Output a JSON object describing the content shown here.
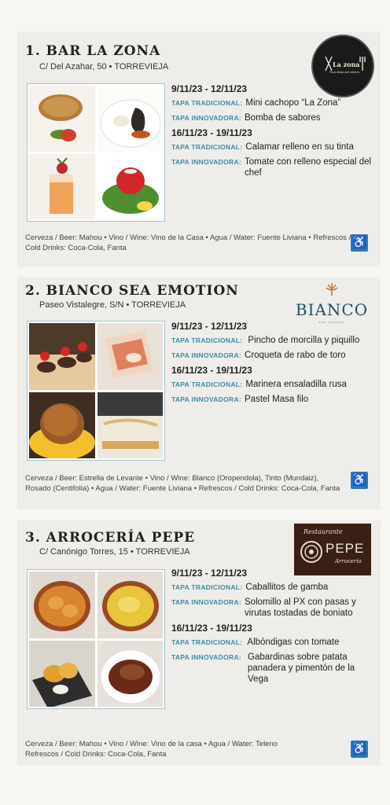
{
  "restaurants": [
    {
      "title": "1. BAR LA ZONA",
      "address": "C/ Del Azahar, 50 • TORREVIEJA",
      "logo": {
        "main": "La zona",
        "sub": "Food drinks and chiches"
      },
      "periods": [
        {
          "date": "9/11/23 - 12/11/23",
          "tapas": [
            {
              "label": "TAPA TRADICIONAL:",
              "text": "Mini cachopo “La Zona”"
            },
            {
              "label": "TAPA INNOVADORA:",
              "text": "Bomba de sabores"
            }
          ]
        },
        {
          "date": "16/11/23 - 19/11/23",
          "tapas": [
            {
              "label": "TAPA TRADICIONAL:",
              "text": "Calamar relleno en su tinta"
            },
            {
              "label": "TAPA INNOVADORA:",
              "text": "Tomate con relleno especial del chef"
            }
          ]
        }
      ],
      "drinks_line1": "Cerveza / Beer: Mahou • Vino / Wine: Vino de la Casa • Agua / Water: Fuente Liviana • Refrescos /",
      "drinks_line2": "Cold Drinks: Coca-Cola, Fanta"
    },
    {
      "title": "2. BIANCO SEA EMOTION",
      "address": "Paseo Vistalegre, S/N • TORREVIEJA",
      "logo": {
        "main": "BIANCO",
        "sub": "sea emotion"
      },
      "periods": [
        {
          "date": "9/11/23 - 12/11/23",
          "tapas": [
            {
              "label": "TAPA TRADICIONAL:",
              "text": "Pincho de morcilla y piquillo"
            },
            {
              "label": "TAPA INNOVADORA:",
              "text": "Croqueta de rabo de toro"
            }
          ]
        },
        {
          "date": "16/11/23 - 19/11/23",
          "tapas": [
            {
              "label": "TAPA TRADICIONAL:",
              "text": "Marinera ensaladilla rusa"
            },
            {
              "label": "TAPA INNOVADORA:",
              "text": "Pastel Masa filo"
            }
          ]
        }
      ],
      "drinks_line1": "Cerveza / Beer: Estrella de Levante • Vino / Wine: Blanco (Oropendola), Tinto (Mundaiz),",
      "drinks_line2": "Rosado (Centifolia) • Agua / Water: Fuente Liviana • Refrescos / Cold Drinks: Coca-Cola, Fanta"
    },
    {
      "title": "3. ARROCERÍA PEPE",
      "address": "C/ Canónigo Torres, 15 • TORREVIEJA",
      "logo": {
        "top": "Restaurante",
        "main": "PEPE",
        "sub": "Arrocería"
      },
      "periods": [
        {
          "date": "9/11/23 - 12/11/23",
          "tapas": [
            {
              "label": "TAPA TRADICIONAL:",
              "text": "Caballitos de gamba"
            },
            {
              "label": "TAPA INNOVADORA:",
              "text": "Solomillo al PX con pasas y virutas tostadas de boniato"
            }
          ]
        },
        {
          "date": "16/11/23 - 19/11/23",
          "tapas": [
            {
              "label": "TAPA TRADICIONAL:",
              "text": "Albóndigas con tomate"
            },
            {
              "label": "TAPA INNOVADORA:",
              "text": "Gabardinas sobre patata panadera y pimentón de la Vega"
            }
          ]
        }
      ],
      "drinks_line1": "Cerveza / Beer: Mahou • Vino / Wine: Vino de la casa • Agua / Water: Teleno",
      "drinks_line2": "Refrescos / Cold Drinks: Coca-Cola, Fanta"
    }
  ],
  "accessibility_icon": "wheelchair-icon",
  "colors": {
    "accent": "#3d8aa8",
    "access": "#2a7ab4",
    "background": "#f7f6f3"
  }
}
